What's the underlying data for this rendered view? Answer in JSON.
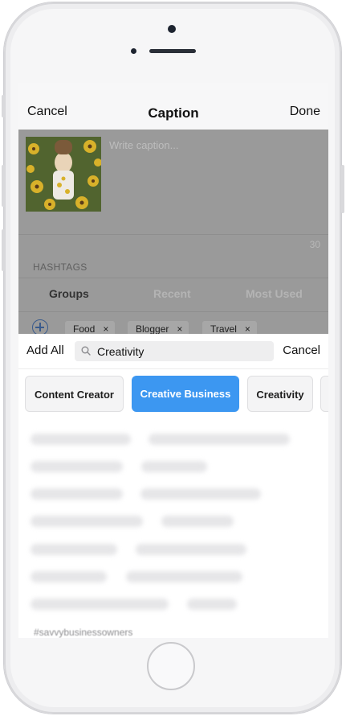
{
  "navbar": {
    "cancel_label": "Cancel",
    "title": "Caption",
    "done_label": "Done"
  },
  "composer": {
    "caption_placeholder": "Write caption...",
    "char_count": "30",
    "hashtags_label": "HASHTAGS"
  },
  "segments": {
    "groups": "Groups",
    "recent": "Recent",
    "most_used": "Most Used",
    "selected": "Groups"
  },
  "selected_tags": [
    {
      "label": "Food",
      "remove": "×"
    },
    {
      "label": "Blogger",
      "remove": "×"
    },
    {
      "label": "Travel",
      "remove": "×"
    }
  ],
  "search": {
    "add_all_label": "Add All",
    "value": "Creativity",
    "cancel_label": "Cancel"
  },
  "groups": [
    {
      "label": "Content Creator",
      "selected": false
    },
    {
      "label": "Creative Business",
      "selected": true
    },
    {
      "label": "Creativity",
      "selected": false
    }
  ],
  "hashtags": {
    "visible_tag": "#savvybusinessowners"
  },
  "colors": {
    "accent": "#3c97f1",
    "overlay": "#9a9a9a"
  }
}
